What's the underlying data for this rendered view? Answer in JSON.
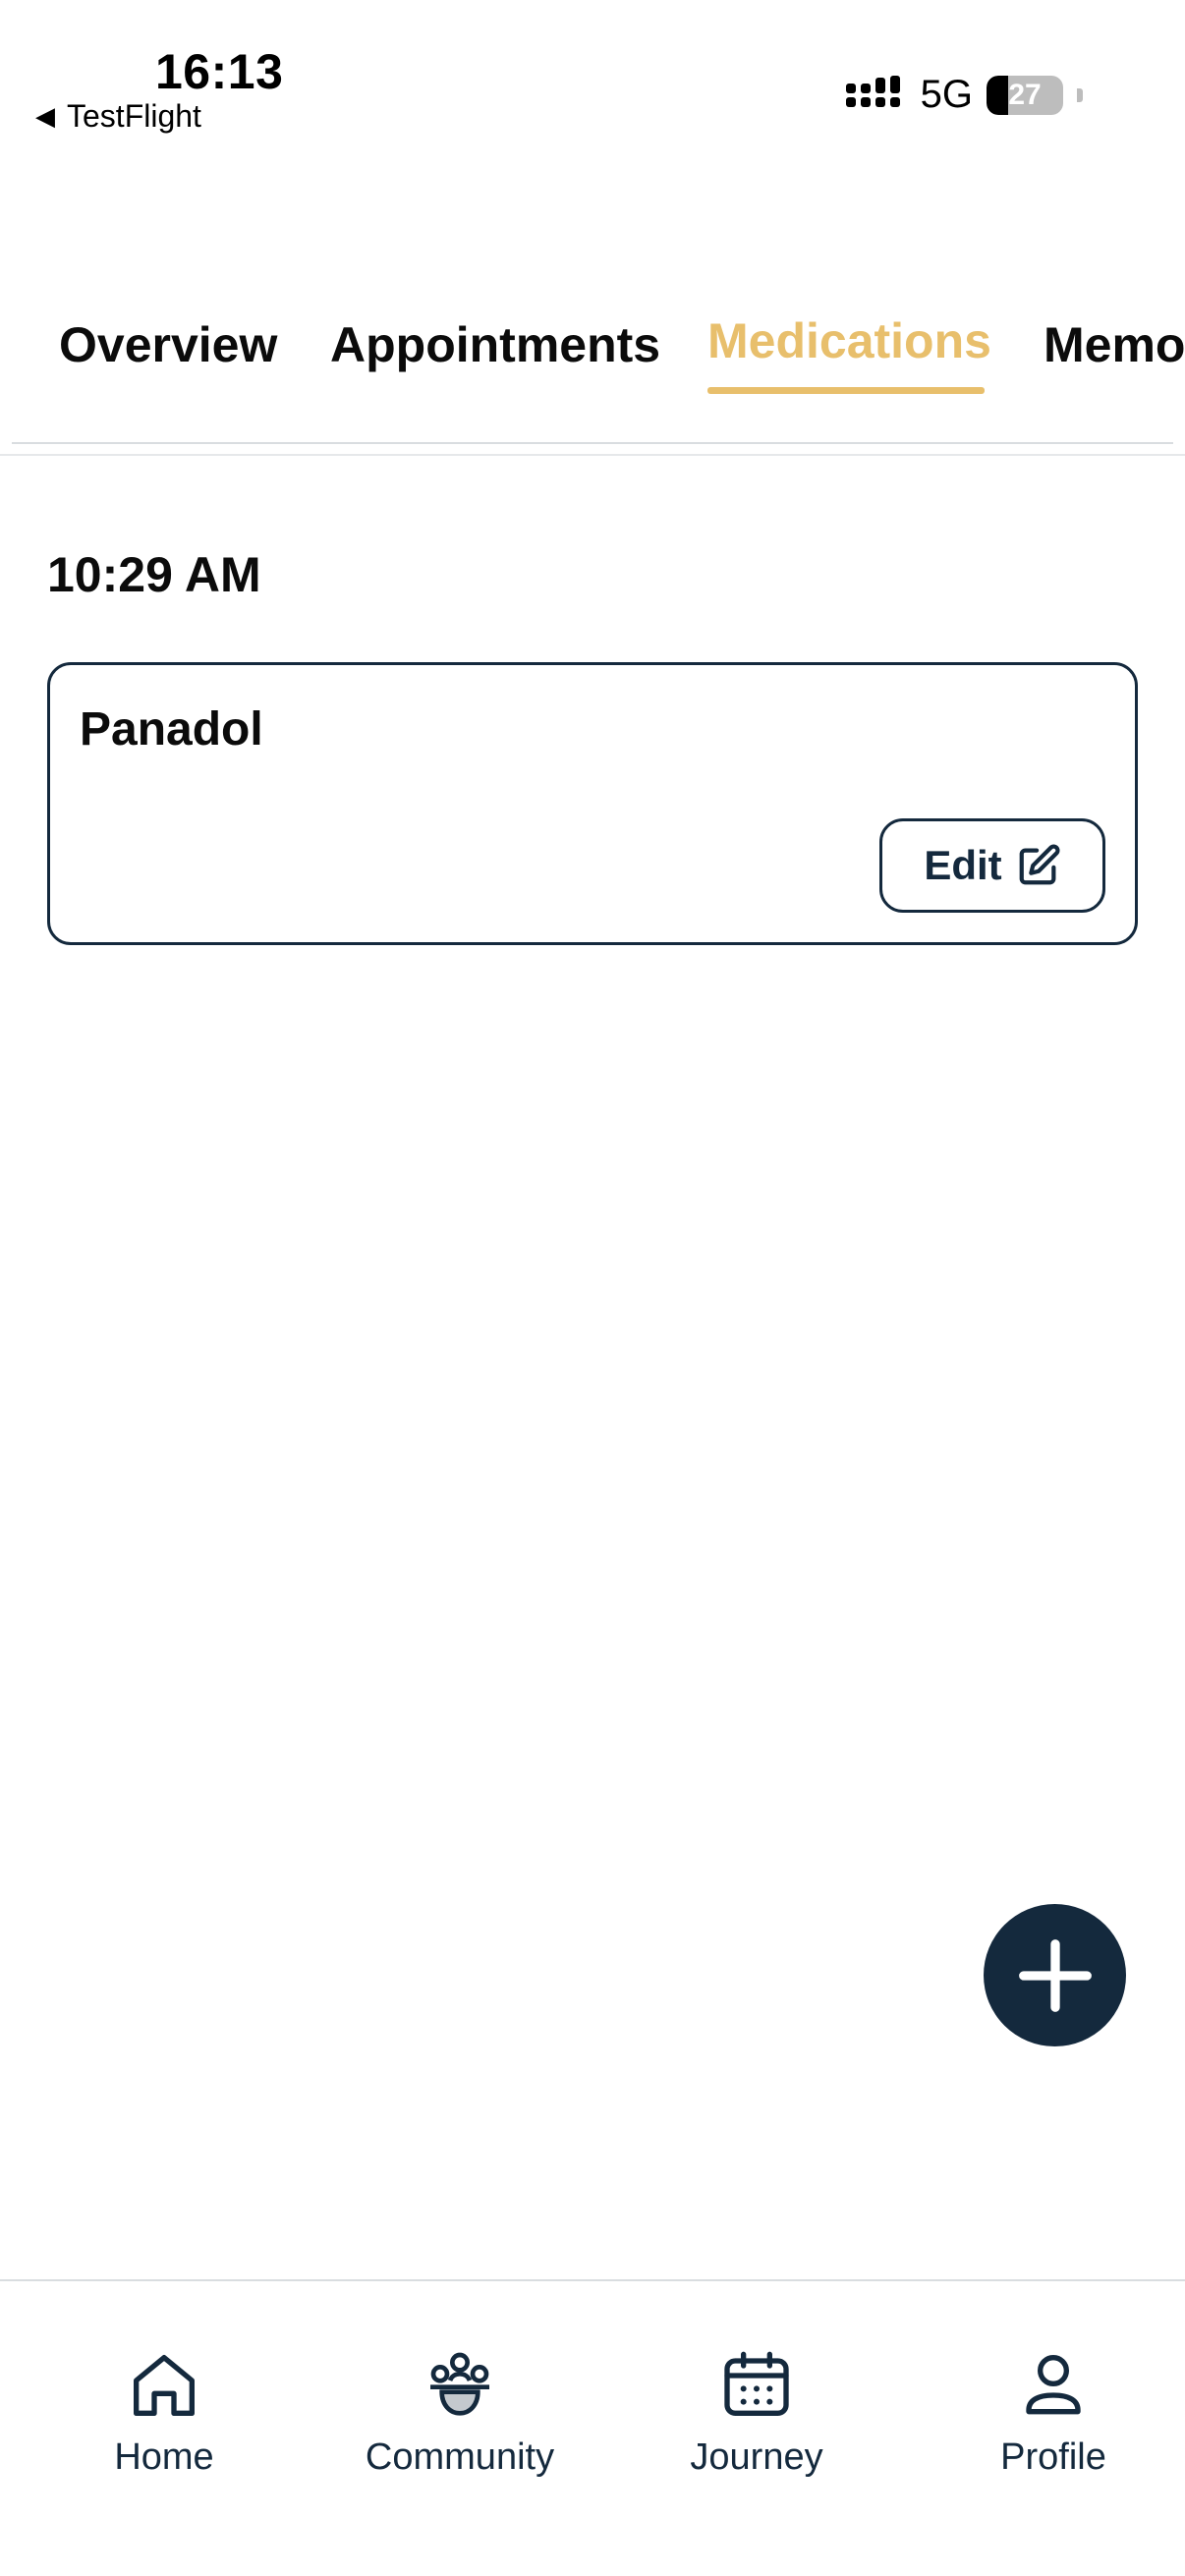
{
  "status_bar": {
    "time": "16:13",
    "back_app": "TestFlight",
    "network": "5G",
    "battery": "27",
    "icons": {
      "back": "back-triangle-icon",
      "signal": "cellular-signal-icon",
      "battery": "battery-icon"
    }
  },
  "tabs": [
    {
      "label": "Overview",
      "active": false
    },
    {
      "label": "Appointments",
      "active": false
    },
    {
      "label": "Medications",
      "active": true
    },
    {
      "label": "Memo",
      "active": false
    }
  ],
  "schedule": {
    "time_label": "10:29 AM",
    "medications": [
      {
        "name": "Panadol",
        "edit_label": "Edit",
        "edit_icon": "edit-icon"
      }
    ]
  },
  "fab": {
    "icon": "plus-icon"
  },
  "bottom_nav": [
    {
      "label": "Home",
      "icon": "home-icon"
    },
    {
      "label": "Community",
      "icon": "community-icon"
    },
    {
      "label": "Journey",
      "icon": "calendar-icon"
    },
    {
      "label": "Profile",
      "icon": "profile-icon"
    }
  ],
  "colors": {
    "accent": "#e8bf6c",
    "primary_dark": "#14293d",
    "divider": "#d9dde0"
  }
}
